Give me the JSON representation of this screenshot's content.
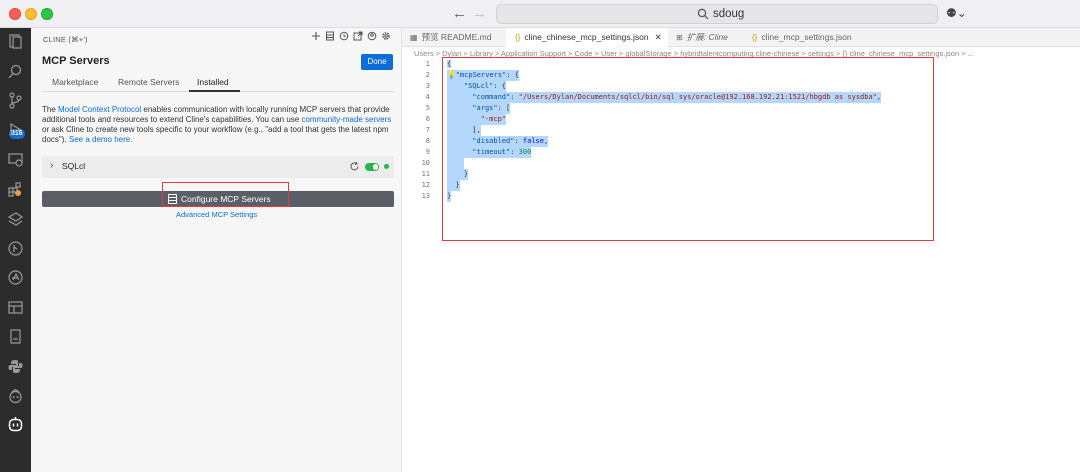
{
  "window": {
    "search_text": "sdoug",
    "colors": {
      "accent": "#0a6dd8",
      "highlight": "#e53a3a",
      "enabled": "#27b24a"
    }
  },
  "activity_bar": {
    "badge_count": "216",
    "icons": [
      "explorer-icon",
      "search-icon",
      "source-control-icon",
      "run-debug-icon",
      "remote-explorer-icon",
      "extensions-icon",
      "database-icon",
      "git-graph-icon",
      "docker-icon",
      "panel-icon",
      "notebook-icon",
      "python-icon",
      "copilot-icon",
      "cline-icon"
    ],
    "more": "..."
  },
  "sidebar": {
    "title": "CLINE (⌘+')",
    "header": "MCP Servers",
    "done_label": "Done",
    "tabs": [
      {
        "label": "Marketplace"
      },
      {
        "label": "Remote Servers"
      },
      {
        "label": "Installed"
      }
    ],
    "description": {
      "part1": "The ",
      "link1": "Model Context Protocol",
      "part2": " enables communication with locally running MCP servers that provide additional tools and resources to extend Cline's capabilities. You can use ",
      "link2": "community-made servers",
      "part3": " or ask Cline to create new tools specific to your workflow (e.g., \"add a tool that gets the latest npm docs\"). ",
      "link3": "See a demo here."
    },
    "server": {
      "name": "SQLcl",
      "enabled": true
    },
    "configure_button": "Configure MCP Servers",
    "advanced_link": "Advanced MCP Settings"
  },
  "editor": {
    "tabs": [
      {
        "icon": "preview-icon",
        "label": "预览 README.md"
      },
      {
        "icon": "json-icon",
        "label": "cline_chinese_mcp_settings.json",
        "active": true,
        "close": "✕"
      },
      {
        "icon": "extension-icon",
        "label": "扩展: Cline"
      },
      {
        "icon": "json-icon",
        "label": "cline_mcp_settings.json"
      }
    ],
    "breadcrumb": "Users > Dylan > Library > Application Support > Code > User > globalStorage > hybridtalentcomputing.cline-chinese > settings > {} cline_chinese_mcp_settings.json > ...",
    "line_numbers": [
      "1",
      "2",
      "3",
      "4",
      "5",
      "6",
      "7",
      "8",
      "9",
      "10",
      "11",
      "12",
      "13"
    ],
    "code": {
      "l1": "{",
      "l2_key": "\"mcpServers\"",
      "l2_rest": ": {",
      "l3_key": "\"SQLcl\"",
      "l3_rest": ": {",
      "l4_key": "\"command\"",
      "l4_colon": ": ",
      "l4_val": "\"/Users/Dylan/Documents/sqlcl/bin/sql sys/oracle@192.168.192.21:1521/hbgdb as sysdba\"",
      "l4_end": ",",
      "l5_key": "\"args\"",
      "l5_rest": ": [",
      "l6_val": "\"-mcp\"",
      "l7": "],",
      "l8_key": "\"disabled\"",
      "l8_colon": ": ",
      "l8_val": "false",
      "l8_end": ",",
      "l9_key": "\"timeout\"",
      "l9_colon": ": ",
      "l9_val": "300",
      "l10": "",
      "l11": "}",
      "l12": "}",
      "l13": "}"
    }
  }
}
